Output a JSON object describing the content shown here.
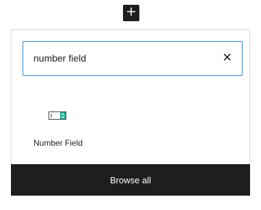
{
  "inserter_toggle": {
    "icon": "plus-icon"
  },
  "search": {
    "value": "number field",
    "clear_icon": "close-icon"
  },
  "results": [
    {
      "label": "Number Field",
      "icon": "number-field-icon",
      "accent": "#1ab394"
    }
  ],
  "footer": {
    "browse_all_label": "Browse all"
  },
  "colors": {
    "focus_border": "#3582c4",
    "dark": "#1e1e1e"
  }
}
